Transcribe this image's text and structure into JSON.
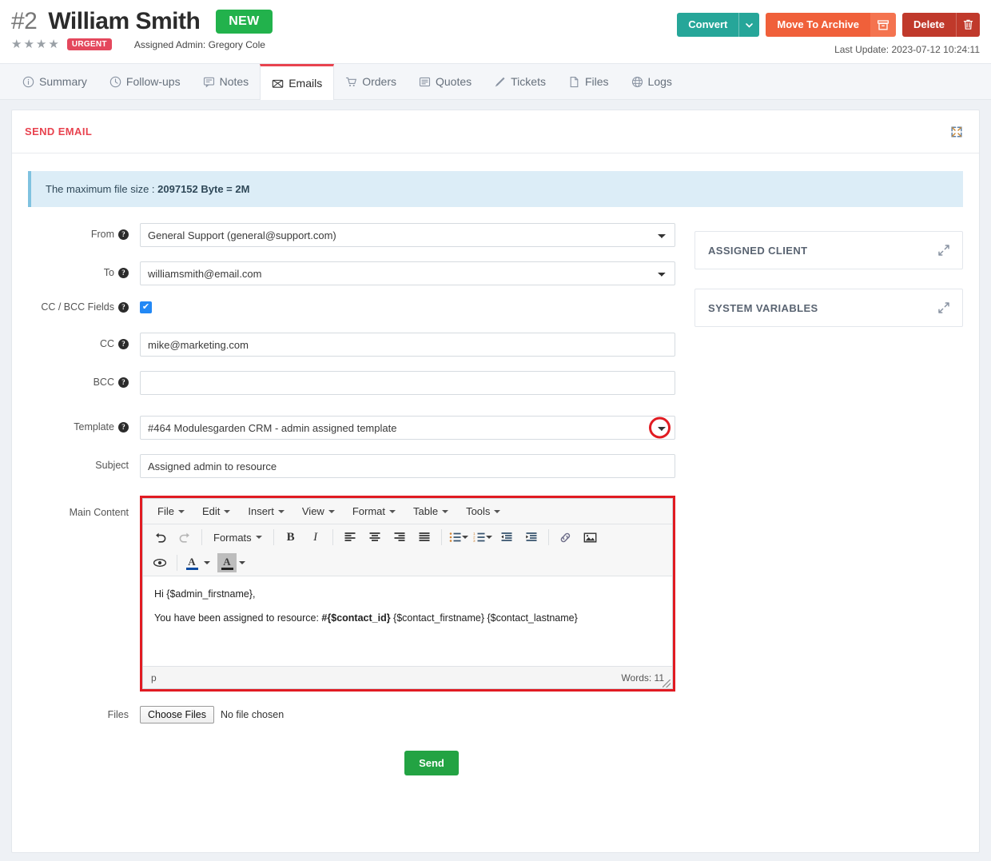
{
  "header": {
    "record_id": "#2",
    "record_name": "William Smith",
    "status_badge": "NEW",
    "stars": 4,
    "priority_badge": "URGENT",
    "assigned_admin": "Assigned Admin: Gregory Cole",
    "last_update": "Last Update: 2023-07-12 10:24:11",
    "actions": {
      "convert": "Convert",
      "convert_caret_icon": "chevron-down-icon",
      "archive": "Move To Archive",
      "archive_icon": "archive-box-icon",
      "delete": "Delete",
      "delete_icon": "trash-icon"
    },
    "colors": {
      "convert": "#26a699",
      "archive": "#f0603a",
      "delete": "#c0392b",
      "new_badge": "#22b24c",
      "urgent_badge": "#e4485d"
    }
  },
  "tabs": [
    {
      "label": "Summary",
      "icon": "info-circle-icon",
      "active": false
    },
    {
      "label": "Follow-ups",
      "icon": "clock-icon",
      "active": false
    },
    {
      "label": "Notes",
      "icon": "note-icon",
      "active": false
    },
    {
      "label": "Emails",
      "icon": "envelope-icon",
      "active": true
    },
    {
      "label": "Orders",
      "icon": "cart-icon",
      "active": false
    },
    {
      "label": "Quotes",
      "icon": "list-icon",
      "active": false
    },
    {
      "label": "Tickets",
      "icon": "ticket-icon",
      "active": false
    },
    {
      "label": "Files",
      "icon": "file-icon",
      "active": false
    },
    {
      "label": "Logs",
      "icon": "globe-icon",
      "active": false
    }
  ],
  "panel": {
    "title": "SEND EMAIL",
    "expand_icon": "expand-arrows-icon",
    "notice_prefix": "The maximum file size : ",
    "notice_value": "2097152 Byte = 2M"
  },
  "form": {
    "from": {
      "label": "From",
      "value": "General Support (general@support.com)",
      "help_icon": "question-mark-icon"
    },
    "to": {
      "label": "To",
      "value": "williamsmith@email.com",
      "help_icon": "question-mark-icon"
    },
    "ccbcc": {
      "label": "CC / BCC Fields",
      "checked": true,
      "check_icon": "checkmark-icon",
      "help_icon": "question-mark-icon"
    },
    "cc": {
      "label": "CC",
      "value": "mike@marketing.com",
      "placeholder": "",
      "help_icon": "question-mark-icon"
    },
    "bcc": {
      "label": "BCC",
      "value": "",
      "placeholder": "",
      "help_icon": "question-mark-icon"
    },
    "template": {
      "label": "Template",
      "value": "#464 Modulesgarden CRM - admin assigned template",
      "help_icon": "question-mark-icon",
      "annotation": "red-circle-highlight",
      "caret_icon": "chevron-down-icon"
    },
    "subject": {
      "label": "Subject",
      "value": "Assigned admin to resource",
      "placeholder": ""
    },
    "main_content": {
      "label": "Main Content"
    },
    "files": {
      "label": "Files",
      "button": "Choose Files",
      "status": "No file chosen"
    },
    "send_button": "Send"
  },
  "editor": {
    "menus": [
      "File",
      "Edit",
      "Insert",
      "View",
      "Format",
      "Table",
      "Tools"
    ],
    "toolbar_row1": [
      {
        "name": "undo-icon",
        "label": ""
      },
      {
        "name": "redo-icon",
        "label": ""
      },
      {
        "name": "formats-dropdown",
        "label": "Formats"
      },
      {
        "name": "bold-icon",
        "label": "B"
      },
      {
        "name": "italic-icon",
        "label": "I"
      },
      {
        "name": "align-left-icon",
        "label": ""
      },
      {
        "name": "align-center-icon",
        "label": ""
      },
      {
        "name": "align-right-icon",
        "label": ""
      },
      {
        "name": "align-justify-icon",
        "label": ""
      },
      {
        "name": "bullet-list-icon",
        "label": ""
      },
      {
        "name": "numbered-list-icon",
        "label": ""
      },
      {
        "name": "outdent-icon",
        "label": ""
      },
      {
        "name": "indent-icon",
        "label": ""
      },
      {
        "name": "link-icon",
        "label": ""
      },
      {
        "name": "image-icon",
        "label": ""
      }
    ],
    "toolbar_row2": [
      {
        "name": "preview-eye-icon",
        "label": ""
      },
      {
        "name": "text-color-icon",
        "label": "A"
      },
      {
        "name": "background-color-icon",
        "label": "A"
      }
    ],
    "content": {
      "line1": "Hi {$admin_firstname},",
      "line2_prefix": "You have been assigned to resource: ",
      "line2_bold": "#{$contact_id}",
      "line2_suffix": " {$contact_firstname} {$contact_lastname}"
    },
    "status_path": "p",
    "word_count": "Words: 11"
  },
  "sidebar": {
    "cards": [
      {
        "title": "ASSIGNED CLIENT",
        "expand_icon": "expand-diagonal-icon"
      },
      {
        "title": "SYSTEM VARIABLES",
        "expand_icon": "expand-diagonal-icon"
      }
    ]
  }
}
